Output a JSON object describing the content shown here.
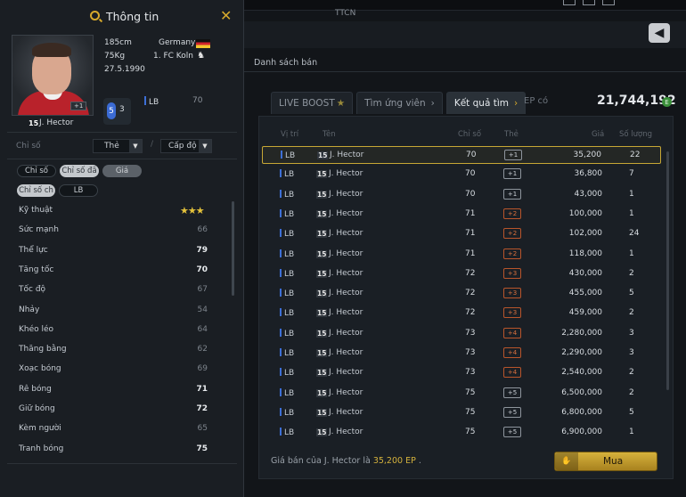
{
  "market": {
    "topbar_label": "TTCN",
    "back_icon": "back-arrow-icon",
    "list_title": "Danh sách bán",
    "tabs": [
      {
        "label": "LIVE BOOST",
        "icon": "star-icon"
      },
      {
        "label": "Tìm ứng viên",
        "icon": "chevron-right-icon"
      },
      {
        "label": "Kết quả tìm",
        "icon": "chevron-right-icon"
      }
    ],
    "ep_label": "EP có",
    "ep_value": "21,744,192",
    "ep_coin": "E",
    "headers": {
      "pos": "Vị trí",
      "name": "Tên",
      "ovr": "Chỉ số",
      "card": "Thẻ",
      "price": "Giá",
      "qty": "Số lượng"
    },
    "rows": [
      {
        "pos": "LB",
        "num": "15",
        "name": "J. Hector",
        "ovr": "70",
        "card": "+1",
        "price": "35,200",
        "qty": "22"
      },
      {
        "pos": "LB",
        "num": "15",
        "name": "J. Hector",
        "ovr": "70",
        "card": "+1",
        "price": "36,800",
        "qty": "7"
      },
      {
        "pos": "LB",
        "num": "15",
        "name": "J. Hector",
        "ovr": "70",
        "card": "+1",
        "price": "43,000",
        "qty": "1"
      },
      {
        "pos": "LB",
        "num": "15",
        "name": "J. Hector",
        "ovr": "71",
        "card": "+2",
        "price": "100,000",
        "qty": "1"
      },
      {
        "pos": "LB",
        "num": "15",
        "name": "J. Hector",
        "ovr": "71",
        "card": "+2",
        "price": "102,000",
        "qty": "24"
      },
      {
        "pos": "LB",
        "num": "15",
        "name": "J. Hector",
        "ovr": "71",
        "card": "+2",
        "price": "118,000",
        "qty": "1"
      },
      {
        "pos": "LB",
        "num": "15",
        "name": "J. Hector",
        "ovr": "72",
        "card": "+3",
        "price": "430,000",
        "qty": "2"
      },
      {
        "pos": "LB",
        "num": "15",
        "name": "J. Hector",
        "ovr": "72",
        "card": "+3",
        "price": "455,000",
        "qty": "5"
      },
      {
        "pos": "LB",
        "num": "15",
        "name": "J. Hector",
        "ovr": "72",
        "card": "+3",
        "price": "459,000",
        "qty": "2"
      },
      {
        "pos": "LB",
        "num": "15",
        "name": "J. Hector",
        "ovr": "73",
        "card": "+4",
        "price": "2,280,000",
        "qty": "3"
      },
      {
        "pos": "LB",
        "num": "15",
        "name": "J. Hector",
        "ovr": "73",
        "card": "+4",
        "price": "2,290,000",
        "qty": "3"
      },
      {
        "pos": "LB",
        "num": "15",
        "name": "J. Hector",
        "ovr": "73",
        "card": "+4",
        "price": "2,540,000",
        "qty": "2"
      },
      {
        "pos": "LB",
        "num": "15",
        "name": "J. Hector",
        "ovr": "75",
        "card": "+5",
        "price": "6,500,000",
        "qty": "2"
      },
      {
        "pos": "LB",
        "num": "15",
        "name": "J. Hector",
        "ovr": "75",
        "card": "+5",
        "price": "6,800,000",
        "qty": "5"
      },
      {
        "pos": "LB",
        "num": "15",
        "name": "J. Hector",
        "ovr": "75",
        "card": "+5",
        "price": "6,900,000",
        "qty": "1"
      }
    ],
    "footer_prefix": "Giá bán của J. Hector là",
    "footer_price": "35,200 EP",
    "footer_suffix": ".",
    "buy_label": "Mua"
  },
  "panel": {
    "title": "Thông tin",
    "height": "185cm",
    "weight": "75Kg",
    "birth": "27.5.1990",
    "nation": "Germany",
    "club": "1. FC Koln",
    "number": "15",
    "name": "J. Hector",
    "photo_badge": "+1",
    "chem_a": "5",
    "chem_b": "3",
    "position": "LB",
    "position_ovr": "70",
    "stat_label": "Chỉ số",
    "select_card": "Thẻ",
    "select_level": "Cấp độ",
    "filter_pills": [
      "Chỉ số",
      "Chỉ số đã",
      "Giá"
    ],
    "sub_pills": [
      "Chỉ số ch",
      "LB"
    ],
    "attributes": [
      {
        "name": "Kỹ thuật",
        "value": "★★★"
      },
      {
        "name": "Sức mạnh",
        "value": "66"
      },
      {
        "name": "Thể lực",
        "value": "79"
      },
      {
        "name": "Tăng tốc",
        "value": "70"
      },
      {
        "name": "Tốc độ",
        "value": "67"
      },
      {
        "name": "Nhảy",
        "value": "54"
      },
      {
        "name": "Khéo léo",
        "value": "64"
      },
      {
        "name": "Thăng bằng",
        "value": "62"
      },
      {
        "name": "Xoạc bóng",
        "value": "69"
      },
      {
        "name": "Rê bóng",
        "value": "71"
      },
      {
        "name": "Giữ bóng",
        "value": "72"
      },
      {
        "name": "Kèm người",
        "value": "65"
      },
      {
        "name": "Tranh bóng",
        "value": "75"
      }
    ]
  },
  "colors": {
    "accent": "#d7aa2c",
    "selected_border": "#c7a735",
    "position_bar": "#3d6fd6",
    "upgrade_orange": "#d9703d"
  }
}
